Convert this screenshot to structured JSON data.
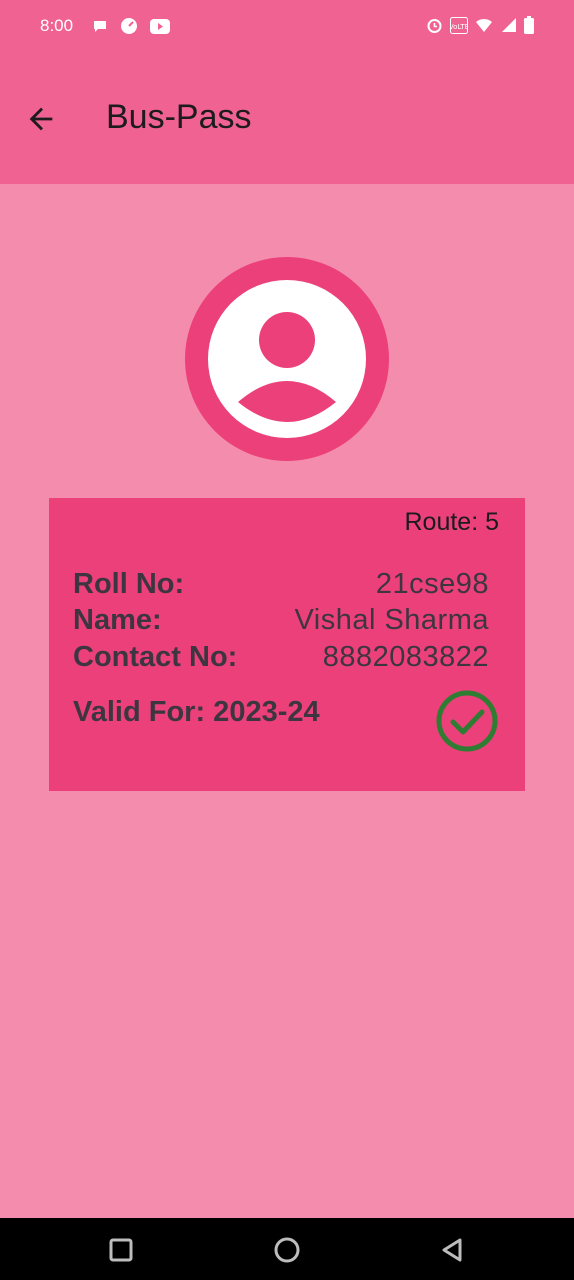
{
  "status_bar": {
    "time": "8:00",
    "left_icons": [
      "chat-icon",
      "speedometer-icon",
      "youtube-icon"
    ],
    "right_icons": [
      "alarm-icon",
      "volte-icon",
      "wifi-icon",
      "signal-icon",
      "battery-icon"
    ],
    "volte_label": "VoLTE"
  },
  "app_bar": {
    "title": "Bus-Pass",
    "back_icon": "arrow-back-icon"
  },
  "profile": {
    "avatar_icon": "account-circle-icon"
  },
  "pass": {
    "route": "Route: 5",
    "fields": [
      {
        "label": "Roll No:",
        "value": "21cse98"
      },
      {
        "label": "Name:",
        "value": "Vishal Sharma"
      },
      {
        "label": "Contact No:",
        "value": "8882083822"
      }
    ],
    "valid_for": "Valid For: 2023-24",
    "status_icon": "check-circle-icon",
    "status_color": "#2e7d32"
  },
  "colors": {
    "app_bar": "#f06292",
    "background": "#f48cae",
    "card": "#ec407a",
    "avatar_ring": "#ec407a"
  },
  "nav_bar": {
    "buttons": [
      "recents-square-icon",
      "home-circle-icon",
      "back-triangle-icon"
    ]
  }
}
